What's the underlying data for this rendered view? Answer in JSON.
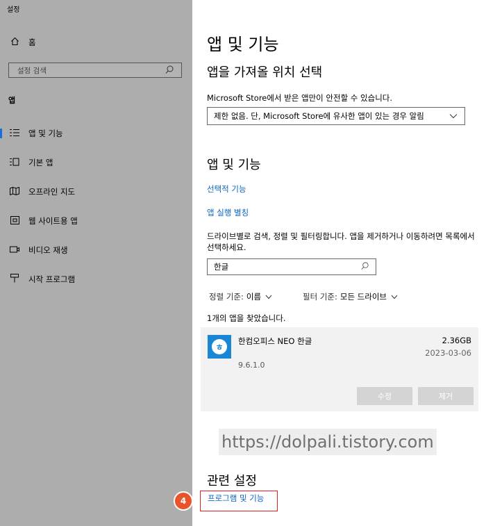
{
  "window": {
    "title": "설정"
  },
  "sidebar": {
    "home": {
      "icon": "home-icon",
      "label": "홈"
    },
    "search": {
      "placeholder": "설정 검색",
      "icon": "search-icon"
    },
    "section": "앱",
    "items": [
      {
        "icon": "apps-features-icon",
        "label": "앱 및 기능",
        "selected": true
      },
      {
        "icon": "default-apps-icon",
        "label": "기본 앱"
      },
      {
        "icon": "offline-maps-icon",
        "label": "오프라인 지도"
      },
      {
        "icon": "web-apps-icon",
        "label": "웹 사이트용 앱"
      },
      {
        "icon": "video-playback-icon",
        "label": "비디오 재생"
      },
      {
        "icon": "startup-icon",
        "label": "시작 프로그램"
      }
    ],
    "accent_color": "#1a6ed8"
  },
  "main": {
    "title": "앱 및 기능",
    "install_heading": "앱을 가져올 위치 선택",
    "install_desc": "Microsoft Store에서 받은 앱만이 안전할 수 있습니다.",
    "install_dropdown": "제한 없음. 단, Microsoft Store에 유사한 앱이 있는 경우 알림",
    "apps_heading": "앱 및 기능",
    "link_optional": "선택적 기능",
    "link_alias": "앱 실행 별칭",
    "search_desc": "드라이브별로 검색, 정렬 및 필터링합니다. 앱을 제거하거나 이동하려면 목록에서 선택하세요.",
    "search_value": "한글",
    "sort_label": "정렬 기준:",
    "sort_value": "이름",
    "filter_label": "필터 기준:",
    "filter_value": "모든 드라이브",
    "result_count": "1개의 앱을 찾았습니다.",
    "app": {
      "name": "한컴오피스 NEO 한글",
      "size": "2.36GB",
      "date": "2023-03-06",
      "version": "9.6.1.0",
      "icon_char": "ㅎ",
      "modify_label": "수정",
      "uninstall_label": "제거"
    },
    "watermark": "https://dolpali.tistory.com",
    "related_heading": "관련 설정",
    "related_link": "프로그램 및 기능",
    "badge": "4",
    "link_color": "#0a66c2",
    "highlight_color": "#e02020",
    "badge_color": "#e8532c"
  }
}
